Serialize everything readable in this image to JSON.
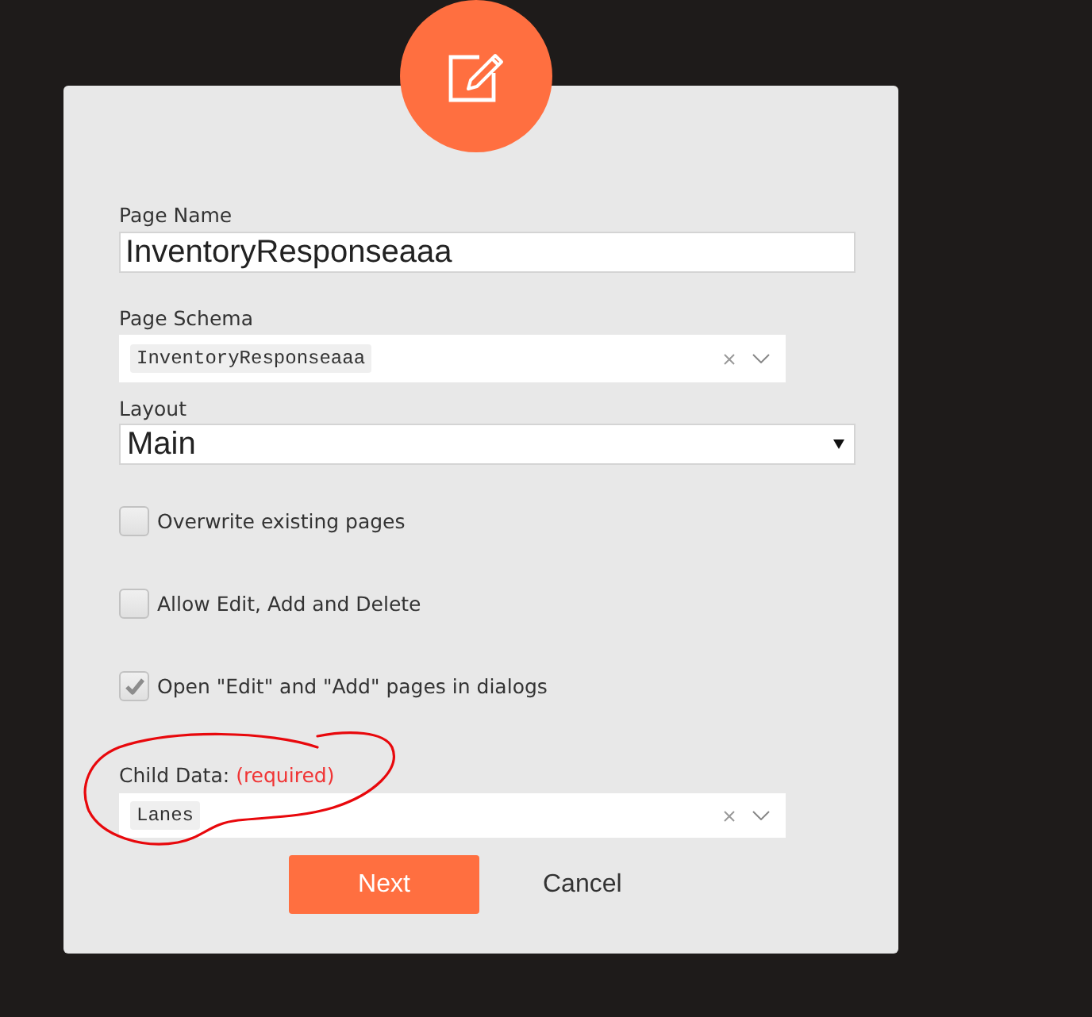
{
  "fields": [
    {
      "kind": "text",
      "label": "Page Name",
      "value": "InventoryResponseaaa"
    },
    {
      "kind": "tag_select",
      "label": "Page Schema",
      "value": "InventoryResponseaaa"
    },
    {
      "kind": "select",
      "label": "Layout",
      "value": "Main"
    }
  ],
  "options": [
    {
      "label": "Overwrite existing pages",
      "checked": false
    },
    {
      "label": "Allow Edit, Add and Delete",
      "checked": false
    },
    {
      "label": "Open \"Edit\" and \"Add\" pages in dialogs",
      "checked": true
    }
  ],
  "child_data": {
    "label": "Child Data:",
    "note": "(required)",
    "value": "Lanes"
  },
  "buttons": [
    {
      "label": "Next",
      "kind": "primary"
    },
    {
      "label": "Cancel",
      "kind": "secondary"
    }
  ]
}
